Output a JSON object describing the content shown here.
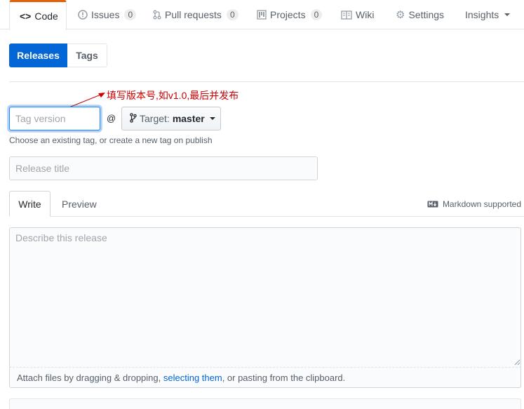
{
  "nav": {
    "tabs": [
      {
        "label": "Code",
        "icon": "code-icon",
        "selected": true
      },
      {
        "label": "Issues",
        "icon": "issue-icon",
        "count": "0"
      },
      {
        "label": "Pull requests",
        "icon": "pull-request-icon",
        "count": "0"
      },
      {
        "label": "Projects",
        "icon": "project-icon",
        "count": "0"
      },
      {
        "label": "Wiki",
        "icon": "book-icon"
      },
      {
        "label": "Settings",
        "icon": "gear-icon"
      },
      {
        "label": "Insights",
        "icon": "dropdown-caret"
      }
    ],
    "accent": "#e36209"
  },
  "subnav": {
    "releases": "Releases",
    "tags": "Tags",
    "active_color": "#0366d6"
  },
  "annotation": {
    "text": "填写版本号,如v1.0,最后并发布",
    "color": "#cc0000"
  },
  "form": {
    "tag_placeholder": "Tag version",
    "at": "@",
    "target_label": "Target:",
    "target_branch": "master",
    "tag_note": "Choose an existing tag, or create a new tag on publish",
    "title_placeholder": "Release title"
  },
  "editor": {
    "write_tab": "Write",
    "preview_tab": "Preview",
    "markdown_supported": "Markdown supported",
    "body_placeholder": "Describe this release",
    "attach_prefix": "Attach files by dragging & dropping, ",
    "attach_link": "selecting them",
    "attach_suffix": ", or pasting from the clipboard."
  }
}
